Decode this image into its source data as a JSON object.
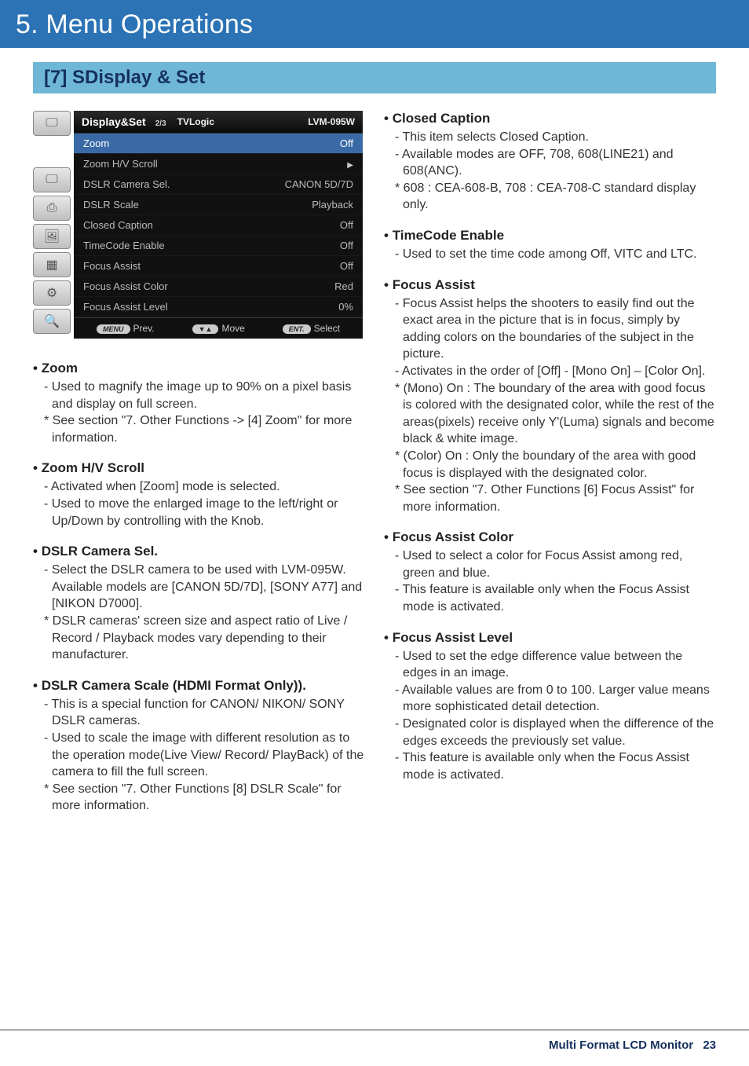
{
  "header": {
    "title": "5. Menu Operations"
  },
  "subheader": {
    "title": "[7] SDisplay & Set"
  },
  "osd": {
    "title_left": "Display&Set",
    "page": "2/3",
    "brand": "TVLogic",
    "model": "LVM-095W",
    "rows": [
      {
        "label": "Zoom",
        "value": "Off",
        "highlight": true
      },
      {
        "label": "Zoom H/V Scroll",
        "value": "",
        "arrow": true
      },
      {
        "label": "DSLR Camera Sel.",
        "value": "CANON 5D/7D"
      },
      {
        "label": "DSLR Scale",
        "value": "Playback"
      },
      {
        "label": "Closed Caption",
        "value": "Off"
      },
      {
        "label": "TimeCode Enable",
        "value": "Off"
      },
      {
        "label": "Focus Assist",
        "value": "Off"
      },
      {
        "label": "Focus Assist Color",
        "value": "Red"
      },
      {
        "label": "Focus Assist Level",
        "value": "0%"
      }
    ],
    "footer": {
      "prev_pill": "MENU",
      "prev": "Prev.",
      "move_pill": "▼▲",
      "move": "Move",
      "select_pill": "ENT.",
      "select": "Select"
    },
    "icon_glyphs": [
      "🖵",
      "🖵",
      "⎙",
      "🖼",
      "▦",
      "⚙",
      "🔍"
    ]
  },
  "left_items": [
    {
      "head": "Zoom",
      "lines": [
        "- Used to magnify the image up to 90% on a pixel basis and display on full screen.",
        "* See section \"7. Other Functions -> [4] Zoom\" for more information."
      ]
    },
    {
      "head": "Zoom H/V Scroll",
      "lines": [
        "- Activated when [Zoom] mode is selected.",
        "- Used to move the enlarged image to the left/right or Up/Down by controlling with the Knob."
      ]
    },
    {
      "head": "DSLR Camera Sel.",
      "lines": [
        "- Select the DSLR camera to be used with LVM-095W. Available models are [CANON 5D/7D], [SONY A77] and [NIKON D7000].",
        "* DSLR cameras' screen size and aspect ratio of Live / Record / Playback modes vary depending to their manufacturer."
      ]
    },
    {
      "head": "DSLR Camera Scale (HDMI Format Only)).",
      "lines": [
        "- This is a special function for CANON/ NIKON/ SONY DSLR cameras.",
        "- Used to scale the image with different resolution as to the operation mode(Live View/ Record/ PlayBack) of the camera to fill the full screen.",
        "* See section \"7. Other Functions [8] DSLR Scale\" for more information."
      ]
    }
  ],
  "right_items": [
    {
      "head": "Closed Caption",
      "lines": [
        "- This item selects Closed Caption.",
        "- Available modes are OFF, 708, 608(LINE21) and 608(ANC).",
        "* 608 : CEA-608-B, 708 : CEA-708-C standard display only."
      ]
    },
    {
      "head": "TimeCode Enable",
      "lines": [
        "- Used to set the time code among Off, VITC and LTC."
      ]
    },
    {
      "head": "Focus Assist",
      "lines": [
        "- Focus Assist helps the shooters to easily find out the exact area in the picture that is in focus, simply by adding colors on the boundaries of the subject in the picture.",
        "- Activates in the order of [Off] - [Mono On] – [Color On].",
        "* (Mono) On : The boundary of the area with good focus is colored with the designated color, while the rest of the areas(pixels) receive only Y'(Luma) signals and become black & white image.",
        "* (Color) On : Only the boundary of the area with good focus is displayed with the designated color.",
        "* See section \"7. Other Functions [6] Focus Assist\" for more information."
      ]
    },
    {
      "head": "Focus Assist Color",
      "lines": [
        "- Used to select a color for Focus Assist among red, green and blue.",
        "- This feature is available only when the Focus Assist mode is activated."
      ]
    },
    {
      "head": "Focus Assist Level",
      "lines": [
        "- Used to set the edge difference value between the edges in an image.",
        "- Available values are from 0 to 100. Larger value means more sophisticated detail detection.",
        "- Designated color is displayed when the difference of the edges exceeds the previously set value.",
        "- This feature is available only when the Focus Assist mode is activated."
      ]
    }
  ],
  "footer": {
    "label": "Multi Format LCD Monitor",
    "page": "23"
  }
}
